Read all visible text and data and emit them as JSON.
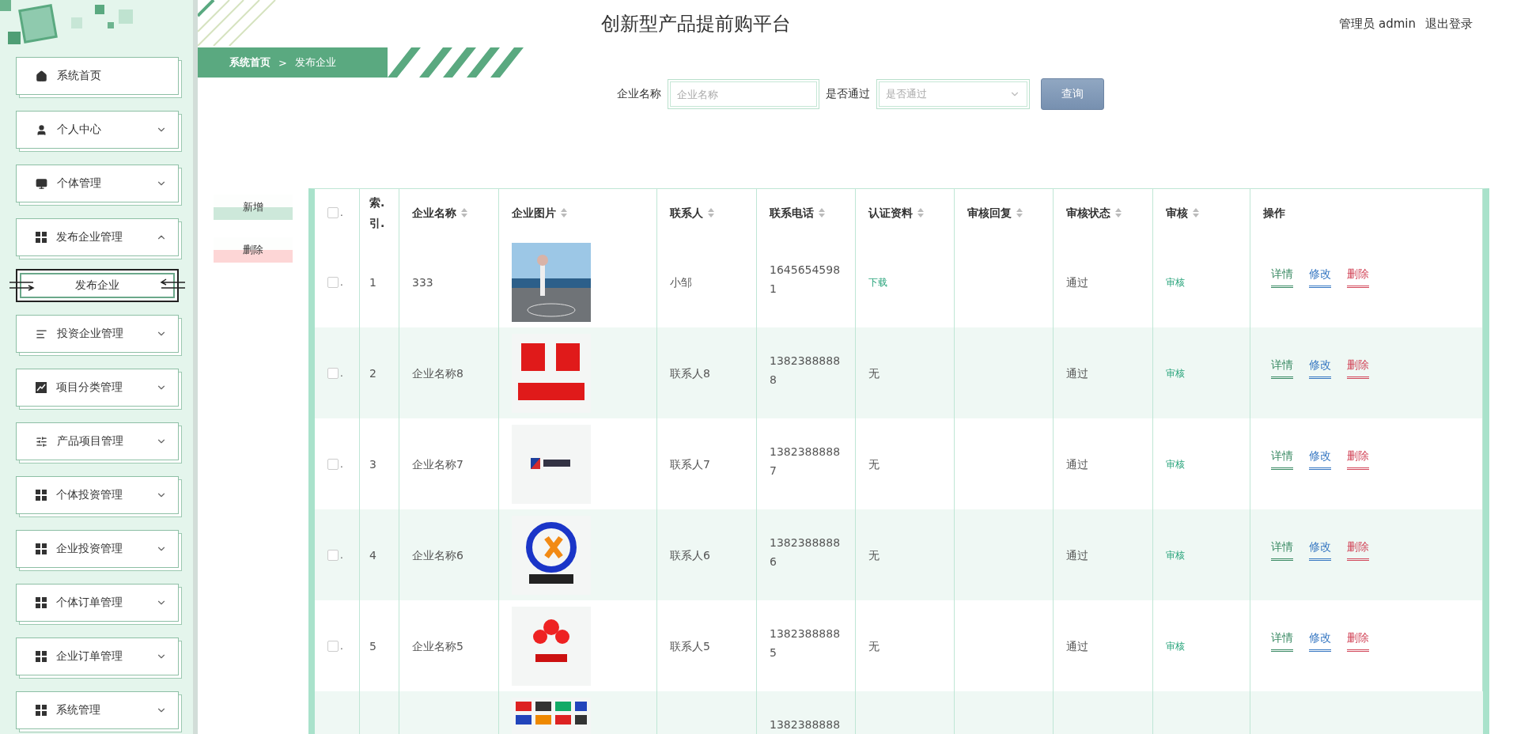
{
  "header": {
    "title": "创新型产品提前购平台",
    "user": "管理员 admin",
    "logout": "退出登录"
  },
  "sidebar": {
    "items": [
      {
        "kind": "link",
        "label": "系统首页"
      },
      {
        "kind": "group",
        "label": "个人中心",
        "expanded": false
      },
      {
        "kind": "group",
        "label": "个体管理",
        "expanded": false
      },
      {
        "kind": "group",
        "label": "发布企业管理",
        "expanded": true,
        "children": [
          {
            "label": "发布企业",
            "selected": true
          }
        ]
      },
      {
        "kind": "group",
        "label": "投资企业管理",
        "expanded": false
      },
      {
        "kind": "group",
        "label": "项目分类管理",
        "expanded": false
      },
      {
        "kind": "group",
        "label": "产品项目管理",
        "expanded": false
      },
      {
        "kind": "group",
        "label": "个体投资管理",
        "expanded": false
      },
      {
        "kind": "group",
        "label": "企业投资管理",
        "expanded": false
      },
      {
        "kind": "group",
        "label": "个体订单管理",
        "expanded": false
      },
      {
        "kind": "group",
        "label": "企业订单管理",
        "expanded": false
      },
      {
        "kind": "group",
        "label": "系统管理",
        "expanded": false
      }
    ]
  },
  "breadcrumb": {
    "items": [
      "系统首页",
      "发布企业"
    ],
    "separator": ">"
  },
  "search": {
    "fields": [
      {
        "kind": "input",
        "label": "企业名称",
        "placeholder": "企业名称"
      },
      {
        "kind": "select",
        "label": "是否通过",
        "placeholder": "是否通过"
      }
    ],
    "button": "查询"
  },
  "actions": [
    {
      "kind": "add",
      "label": "新增"
    },
    {
      "kind": "delete",
      "label": "删除"
    }
  ],
  "table": {
    "select_all": {
      "checked": false,
      "mark": "."
    },
    "columns": [
      {
        "label": "索.引.",
        "sortable": false
      },
      {
        "label": "企业名称",
        "sortable": true
      },
      {
        "label": "企业图片",
        "sortable": true
      },
      {
        "label": "联系人",
        "sortable": true
      },
      {
        "label": "联系电话",
        "sortable": true
      },
      {
        "label": "认证资料",
        "sortable": true
      },
      {
        "label": "审核回复",
        "sortable": true
      },
      {
        "label": "审核状态",
        "sortable": true
      },
      {
        "label": "审核",
        "sortable": true
      },
      {
        "label": "操作",
        "sortable": false
      }
    ],
    "rows": [
      {
        "select": {
          "checked": false,
          "mark": "."
        },
        "index": "1",
        "name": "333",
        "contact": "小邹",
        "phone": "16456545981",
        "certificate": {
          "kind": "link",
          "text": "下载"
        },
        "status": "通过",
        "audit": "审核",
        "actions": [
          "详情",
          "修改",
          "删除"
        ]
      },
      {
        "select": {
          "checked": false,
          "mark": "."
        },
        "index": "2",
        "name": "企业名称8",
        "contact": "联系人8",
        "phone": "13823888888",
        "certificate": {
          "kind": "text",
          "text": "无"
        },
        "status": "通过",
        "audit": "审核",
        "actions": [
          "详情",
          "修改",
          "删除"
        ]
      },
      {
        "select": {
          "checked": false,
          "mark": "."
        },
        "index": "3",
        "name": "企业名称7",
        "contact": "联系人7",
        "phone": "13823888887",
        "certificate": {
          "kind": "text",
          "text": "无"
        },
        "status": "通过",
        "audit": "审核",
        "actions": [
          "详情",
          "修改",
          "删除"
        ]
      },
      {
        "select": {
          "checked": false,
          "mark": "."
        },
        "index": "4",
        "name": "企业名称6",
        "contact": "联系人6",
        "phone": "13823888886",
        "certificate": {
          "kind": "text",
          "text": "无"
        },
        "status": "通过",
        "audit": "审核",
        "actions": [
          "详情",
          "修改",
          "删除"
        ]
      },
      {
        "select": {
          "checked": false,
          "mark": "."
        },
        "index": "5",
        "name": "企业名称5",
        "contact": "联系人5",
        "phone": "13823888885",
        "certificate": {
          "kind": "text",
          "text": "无"
        },
        "status": "通过",
        "audit": "审核",
        "actions": [
          "详情",
          "修改",
          "删除"
        ]
      },
      {
        "phone": "1382388888"
      }
    ]
  }
}
